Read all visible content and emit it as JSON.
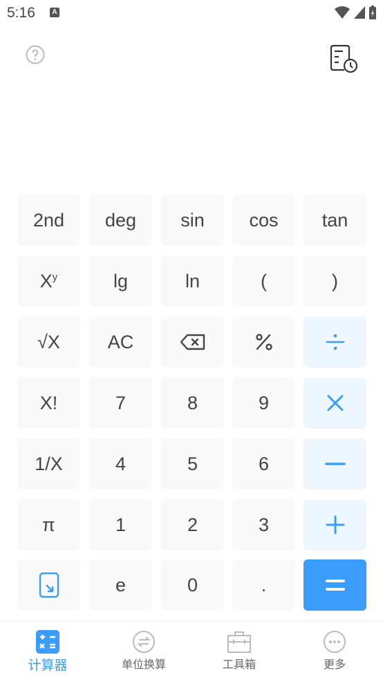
{
  "status_bar": {
    "time": "5:16",
    "notification_icon": "A"
  },
  "header": {
    "help_icon": "help-circle-icon",
    "history_icon": "history-icon"
  },
  "display": {
    "expression": "",
    "result": ""
  },
  "keypad": {
    "rows": [
      [
        {
          "label": "2nd"
        },
        {
          "label": "deg"
        },
        {
          "label": "sin"
        },
        {
          "label": "cos"
        },
        {
          "label": "tan"
        }
      ],
      [
        {
          "label": "X",
          "sup": "y"
        },
        {
          "label": "lg"
        },
        {
          "label": "ln"
        },
        {
          "label": "("
        },
        {
          "label": ")"
        }
      ],
      [
        {
          "label": "√X"
        },
        {
          "label": "AC"
        },
        {
          "label": "",
          "icon": "backspace-icon"
        },
        {
          "label": "%"
        },
        {
          "label": "÷"
        }
      ],
      [
        {
          "label": "X!"
        },
        {
          "label": "7"
        },
        {
          "label": "8"
        },
        {
          "label": "9"
        },
        {
          "label": "×"
        }
      ],
      [
        {
          "label": "1/X"
        },
        {
          "label": "4"
        },
        {
          "label": "5"
        },
        {
          "label": "6"
        },
        {
          "label": "−"
        }
      ],
      [
        {
          "label": "π"
        },
        {
          "label": "1"
        },
        {
          "label": "2"
        },
        {
          "label": "3"
        },
        {
          "label": "+"
        }
      ],
      [
        {
          "label": "",
          "icon": "collapse-icon"
        },
        {
          "label": "e"
        },
        {
          "label": "0"
        },
        {
          "label": "."
        },
        {
          "label": "="
        }
      ]
    ]
  },
  "colors": {
    "accent": "#3a9dfb",
    "operator_bg": "#eef6ff",
    "key_bg": "#f9f9f9"
  },
  "bottom_nav": {
    "items": [
      {
        "label": "计算器",
        "active": true
      },
      {
        "label": "单位换算",
        "active": false
      },
      {
        "label": "工具箱",
        "active": false
      },
      {
        "label": "更多",
        "active": false
      }
    ]
  }
}
